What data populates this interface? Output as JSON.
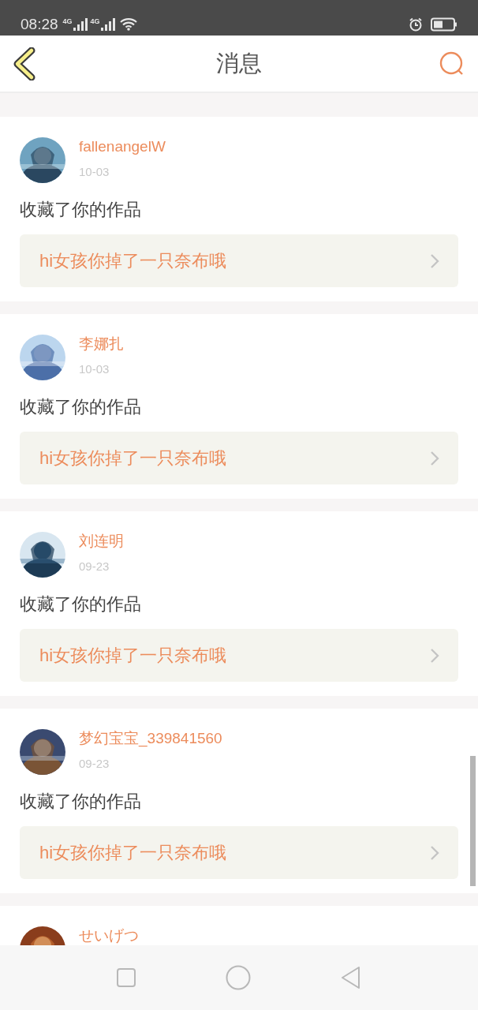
{
  "status_bar": {
    "time": "08:28",
    "signals": [
      {
        "label": "4G"
      },
      {
        "label": "4G"
      }
    ]
  },
  "header": {
    "title": "消息"
  },
  "messages": [
    {
      "user": "fallenangelW",
      "date": "10-03",
      "action": "收藏了你的作品",
      "work": "hi女孩你掉了一只奈布哦"
    },
    {
      "user": "李娜扎",
      "date": "10-03",
      "action": "收藏了你的作品",
      "work": "hi女孩你掉了一只奈布哦"
    },
    {
      "user": "刘连明",
      "date": "09-23",
      "action": "收藏了你的作品",
      "work": "hi女孩你掉了一只奈布哦"
    },
    {
      "user": "梦幻宝宝_339841560",
      "date": "09-23",
      "action": "收藏了你的作品",
      "work": "hi女孩你掉了一只奈布哦"
    },
    {
      "user": "せいげつ"
    }
  ]
}
